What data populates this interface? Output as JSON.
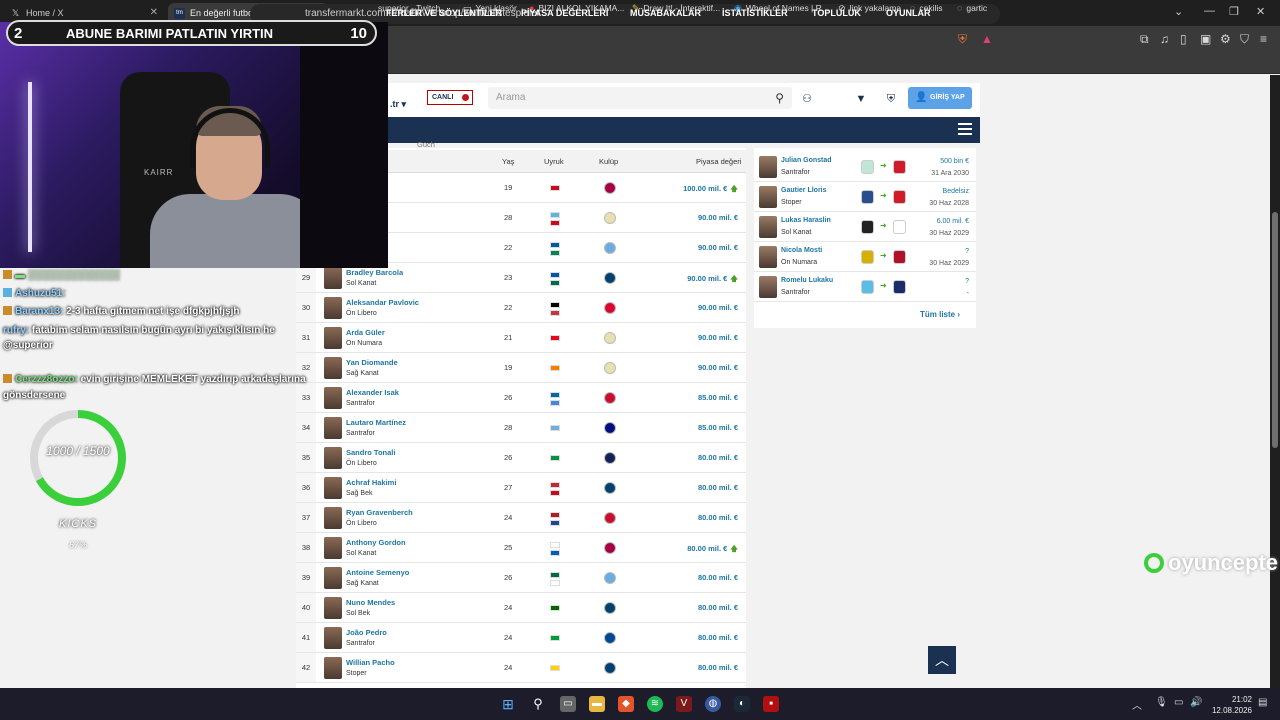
{
  "browser": {
    "tabs": [
      {
        "title": "Home / X",
        "icon": "x-logo-icon"
      },
      {
        "title": "En değerli futbolcular | Transfer",
        "icon": "transfermarkt-icon"
      }
    ],
    "url": "transfermarkt.com.tr/marktwertetop/wertvollstespieler",
    "bookmarks": [
      "superior - Twitch",
      "Yeni klasör",
      "BIZI ALKOL YIKAMA...",
      "Draw It! - İnteraktif...",
      "Wheel of Names | R...",
      "link yakalama",
      "cekilis",
      "gartic"
    ]
  },
  "site": {
    "logo_suffix": ".tr",
    "live_label": "CANLI",
    "search_placeholder": "Arama",
    "login_label": "GİRİŞ YAP",
    "nav": [
      "FERLER VE SÖYLENTİLER",
      "PİYASA DEĞERLERİ",
      "MÜSABAKALAR",
      "İSTATİSTİKLER",
      "TOPLULUK",
      "OYUNLAR"
    ],
    "table_headers": {
      "age": "Yaş",
      "nationality": "Uyruk",
      "club": "Kulüp",
      "market_value": "Piyasa değeri",
      "partial": "Güch"
    }
  },
  "players": [
    {
      "rank": "",
      "name": "",
      "position": "",
      "age": "19",
      "flags": [
        "#c60b1e"
      ],
      "club": "#a50044",
      "value": "100.00 mil. €",
      "up": true
    },
    {
      "rank": "",
      "name": "lverde",
      "position": "Saha",
      "age": "28",
      "flags": [
        "#5eb6e4",
        "#c60b1e"
      ],
      "club": "#e8e0b0",
      "value": "90.00 mil. €",
      "up": false
    },
    {
      "rank": "",
      "name": "ki",
      "position": "",
      "age": "22",
      "flags": [
        "#0055a4",
        "#008751"
      ],
      "club": "#6caddf",
      "value": "90.00 mil. €",
      "up": false
    },
    {
      "rank": "29",
      "name": "Bradley Barcola",
      "position": "Sol Kanat",
      "age": "23",
      "flags": [
        "#0055a4",
        "#006a4e"
      ],
      "club": "#004170",
      "value": "90.00 mil. €",
      "up": true
    },
    {
      "rank": "30",
      "name": "Aleksandar Pavlovic",
      "position": "Ön Libero",
      "age": "22",
      "flags": [
        "#000000",
        "#c6363c"
      ],
      "club": "#dc052d",
      "value": "90.00 mil. €",
      "up": false
    },
    {
      "rank": "31",
      "name": "Arda Güler",
      "position": "On Numara",
      "age": "21",
      "flags": [
        "#e30a17"
      ],
      "club": "#e8e0b0",
      "value": "90.00 mil. €",
      "up": false
    },
    {
      "rank": "32",
      "name": "Yan Diomande",
      "position": "Sağ Kanat",
      "age": "19",
      "flags": [
        "#f77f00"
      ],
      "club": "#e8e0b0",
      "value": "90.00 mil. €",
      "up": false
    },
    {
      "rank": "33",
      "name": "Alexander Isak",
      "position": "Santrafor",
      "age": "26",
      "flags": [
        "#006aa7",
        "#4189dd"
      ],
      "club": "#c8102e",
      "value": "85.00 mil. €",
      "up": false
    },
    {
      "rank": "34",
      "name": "Lautaro Martínez",
      "position": "Santrafor",
      "age": "28",
      "flags": [
        "#74acdf"
      ],
      "club": "#010e80",
      "value": "85.00 mil. €",
      "up": false
    },
    {
      "rank": "35",
      "name": "Sandro Tonali",
      "position": "Ön Libero",
      "age": "26",
      "flags": [
        "#009246"
      ],
      "club": "#132257",
      "value": "80.00 mil. €",
      "up": false
    },
    {
      "rank": "36",
      "name": "Achraf Hakimi",
      "position": "Sağ Bek",
      "age": "27",
      "flags": [
        "#c1272d",
        "#c60b1e"
      ],
      "club": "#004170",
      "value": "80.00 mil. €",
      "up": false
    },
    {
      "rank": "37",
      "name": "Ryan Gravenberch",
      "position": "Ön Libero",
      "age": "24",
      "flags": [
        "#ae1c28",
        "#21468b"
      ],
      "club": "#c8102e",
      "value": "80.00 mil. €",
      "up": false
    },
    {
      "rank": "38",
      "name": "Anthony Gordon",
      "position": "Sol Kanat",
      "age": "25",
      "flags": [
        "#ffffff",
        "#005eb8"
      ],
      "club": "#a50044",
      "value": "80.00 mil. €",
      "up": true
    },
    {
      "rank": "39",
      "name": "Antoine Semenyo",
      "position": "Sağ Kanat",
      "age": "26",
      "flags": [
        "#006b3f",
        "#ffffff"
      ],
      "club": "#6caddf",
      "value": "80.00 mil. €",
      "up": false
    },
    {
      "rank": "40",
      "name": "Nuno Mendes",
      "position": "Sol Bek",
      "age": "24",
      "flags": [
        "#006600"
      ],
      "club": "#004170",
      "value": "80.00 mil. €",
      "up": false
    },
    {
      "rank": "41",
      "name": "João Pedro",
      "position": "Santrafor",
      "age": "24",
      "flags": [
        "#009c3b"
      ],
      "club": "#034694",
      "value": "80.00 mil. €",
      "up": false
    },
    {
      "rank": "42",
      "name": "Willian Pacho",
      "position": "Stoper",
      "age": "24",
      "flags": [
        "#ffd100"
      ],
      "club": "#004170",
      "value": "80.00 mil. €",
      "up": false
    }
  ],
  "transfers": [
    {
      "name": "Julian Gonstad",
      "position": "Santrafor",
      "fee": "500 bin €",
      "until": "31 Ara 2030",
      "from": "#bfe6d6",
      "to": "#d11a2a"
    },
    {
      "name": "Gautier Lloris",
      "position": "Stoper",
      "fee": "Bedelsiz",
      "until": "30 Haz 2028",
      "from": "#2a4d8f",
      "to": "#d11a2a"
    },
    {
      "name": "Lukas Haraslin",
      "position": "Sol Kanat",
      "fee": "6.00 mil. €",
      "until": "30 Haz 2029",
      "from": "#222222",
      "to": "#ffffff"
    },
    {
      "name": "Nicola Mosti",
      "position": "On Numara",
      "fee": "?",
      "until": "30 Haz 2029",
      "from": "#d8b000",
      "to": "#b0122a"
    },
    {
      "name": "Romelu Lukaku",
      "position": "Santrafor",
      "fee": "?",
      "until": "-",
      "from": "#5bbde4",
      "to": "#1b2c6b"
    }
  ],
  "transfers_link": "Tüm liste",
  "stream": {
    "banner_left": "2",
    "banner_text": "ABUNE BARIMI PATLATIN YIRTIN",
    "banner_right": "10",
    "chair_brand": "KAIRR",
    "goal_text": "1000 / 1500",
    "goal_label": "KICKS",
    "goal_pct": "67%",
    "goal_fraction": 0.67,
    "sponsor": "oyuncepte"
  },
  "chat": [
    {
      "user": "Ashuzu51:",
      "msg": ""
    },
    {
      "user": "Baranx13:",
      "msg": "2-3 hafta gitmem net işe dfgkpjhfjşjh"
    },
    {
      "user": "rufry:",
      "msg": "fatabim selam nasılsın bugün ayrı bi yakışıklısın he"
    },
    {
      "user": "",
      "msg": "@superior"
    },
    {
      "user": "Cerzzz8ozzo:",
      "msg": "evin girişine MEMLEKET yazdırıp arkadaşlarına"
    },
    {
      "user": "",
      "msg": "gönsdersene"
    }
  ],
  "taskbar": {
    "time": "21:02",
    "date": "12.08.2026"
  }
}
